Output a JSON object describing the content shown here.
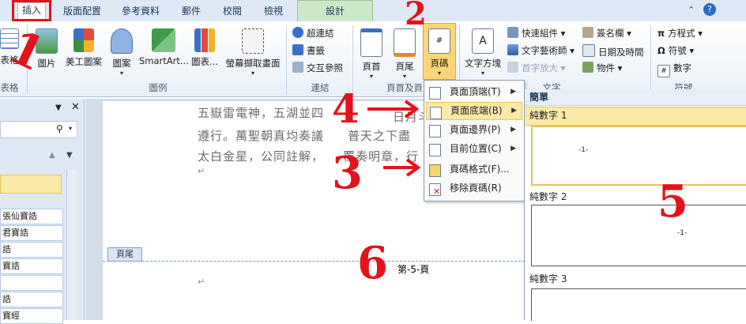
{
  "tabs": [
    {
      "label": "插入",
      "active": true
    },
    {
      "label": "版面配置"
    },
    {
      "label": "參考資料"
    },
    {
      "label": "郵件"
    },
    {
      "label": "校閱"
    },
    {
      "label": "檢視"
    },
    {
      "label": "設計",
      "contextual": true
    }
  ],
  "ribbon": {
    "groups": {
      "tables": "表格",
      "illustrations": "圖例",
      "links": "連結",
      "header_footer": "頁首及頁",
      "text": "文字",
      "symbols": "符號"
    },
    "buttons": {
      "table": "表格",
      "picture": "圖片",
      "clip_art": "美工圖案",
      "shapes": "圖案",
      "smartart": "SmartArt...",
      "chart": "圖表...",
      "screenshot": "螢幕擷取畫面",
      "hyperlink": "超連結",
      "bookmark": "書籤",
      "cross_ref": "交互參照",
      "header": "頁首",
      "footer": "頁尾",
      "page_number": "頁碼",
      "text_box": "文字方塊",
      "quick_parts": "快速組件",
      "wordart": "文字藝術師",
      "drop_cap": "首字放大",
      "signature": "簽名欄",
      "date_time": "日期及時間",
      "object": "物件",
      "equation": "方程式",
      "symbol": "符號",
      "number": "數字"
    }
  },
  "nav_items": [
    "張仙寶誥",
    "君寶誥",
    "誥",
    "寶誥",
    "",
    "誥",
    "寶經"
  ],
  "document": {
    "lines": [
      "五嶽雷電神，五湖並四",
      "遵行。萬聖朝真均奏議",
      "太白金星，公同註解，"
    ],
    "line1_tail": "日月斗",
    "line2_tail": "普天之下盡",
    "line3_tail": "覆奏明章，行",
    "footer_tag": "頁尾",
    "page_number_text": "第-5-頁"
  },
  "menu": {
    "items": [
      {
        "label": "頁面頂端(T)",
        "arrow": true
      },
      {
        "label": "頁面底端(B)",
        "arrow": true,
        "highlight": true
      },
      {
        "label": "頁面邊界(P)",
        "arrow": true
      },
      {
        "label": "目前位置(C)",
        "arrow": true
      },
      {
        "label": "頁碼格式(F)..."
      },
      {
        "label": "移除頁碼(R)"
      }
    ]
  },
  "gallery": {
    "section": "簡單",
    "items": [
      {
        "label": "純數字 1",
        "preview": "-1-"
      },
      {
        "label": "純數字 2",
        "preview": "-1-"
      },
      {
        "label": "純數字 3"
      }
    ]
  },
  "annotations": [
    "1",
    "2",
    "3",
    "4",
    "5",
    "6"
  ],
  "colors": {
    "annotation": "#e3121b",
    "highlight": "#fde9a8",
    "ribbon_tab_bg": "#dfe9f5"
  }
}
